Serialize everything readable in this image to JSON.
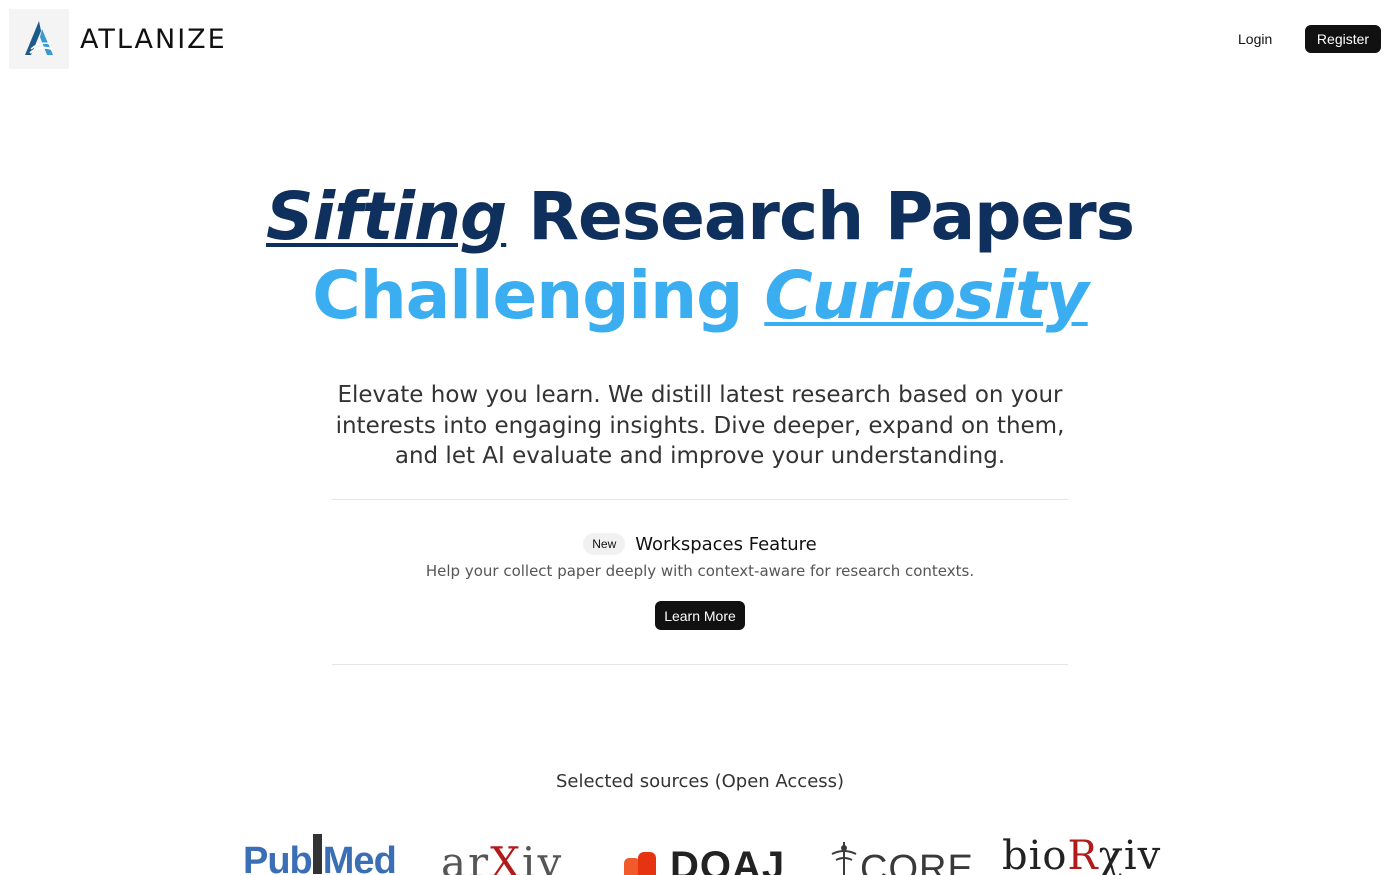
{
  "header": {
    "logo_icon": "atlanize-logo-icon",
    "brand": "ATLANIZE",
    "login_label": "Login",
    "register_label": "Register"
  },
  "hero": {
    "line1_emph": "Sifting",
    "line1_rest": "Research Papers",
    "line2_rest": "Challenging",
    "line2_emph": "Curiosity",
    "subtitle": "Elevate how you learn. We distill latest research based on your interests into engaging insights. Dive deeper, expand on them, and let AI evaluate and improve your understanding."
  },
  "feature": {
    "badge": "New",
    "title": "Workspaces Feature",
    "description": "Help your collect paper deeply with context-aware for research contexts.",
    "button_label": "Learn More"
  },
  "sources": {
    "label": "Selected sources (Open Access)",
    "items": [
      {
        "name": "PubMed",
        "part1": "Pub",
        "part2": "Med"
      },
      {
        "name": "arXiv",
        "part1": "ar",
        "part2": "X",
        "part3": "iv"
      },
      {
        "name": "DOAJ",
        "text": "DOAJ"
      },
      {
        "name": "CORE",
        "text": "CORE"
      },
      {
        "name": "bioRxiv",
        "part1": "bio",
        "part2": "R",
        "part3": "χiv"
      }
    ]
  },
  "colors": {
    "navy": "#0f2f5c",
    "sky": "#3aaef0",
    "button_dark": "#111111"
  }
}
